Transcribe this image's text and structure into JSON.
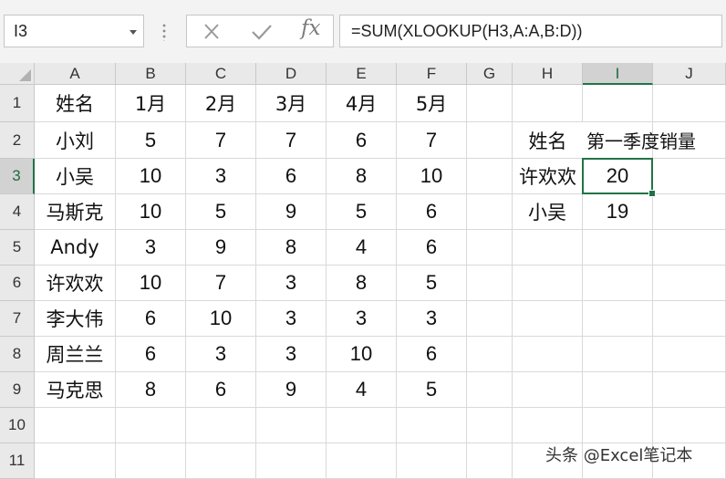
{
  "formula_bar": {
    "name_box": "I3",
    "cancel_icon": "close-icon",
    "enter_icon": "check-icon",
    "function_label": "fx",
    "formula": "=SUM(XLOOKUP(H3,A:A,B:D))"
  },
  "sheet": {
    "columns": [
      "A",
      "B",
      "C",
      "D",
      "E",
      "F",
      "G",
      "H",
      "I",
      "J"
    ],
    "rows": [
      "1",
      "2",
      "3",
      "4",
      "5",
      "6",
      "7",
      "8",
      "9",
      "10",
      "11"
    ],
    "selected_cell": "I3",
    "accent_color": "#217346",
    "cells": {
      "A1": "姓名",
      "B1": "1月",
      "C1": "2月",
      "D1": "3月",
      "E1": "4月",
      "F1": "5月",
      "A2": "小刘",
      "B2": "5",
      "C2": "7",
      "D2": "7",
      "E2": "6",
      "F2": "7",
      "A3": "小吴",
      "B3": "10",
      "C3": "3",
      "D3": "6",
      "E3": "8",
      "F3": "10",
      "A4": "马斯克",
      "B4": "10",
      "C4": "5",
      "D4": "9",
      "E4": "5",
      "F4": "6",
      "A5": "Andy",
      "B5": "3",
      "C5": "9",
      "D5": "8",
      "E5": "4",
      "F5": "6",
      "A6": "许欢欢",
      "B6": "10",
      "C6": "7",
      "D6": "3",
      "E6": "8",
      "F6": "5",
      "A7": "李大伟",
      "B7": "6",
      "C7": "10",
      "D7": "3",
      "E7": "3",
      "F7": "3",
      "A8": "周兰兰",
      "B8": "6",
      "C8": "3",
      "D8": "3",
      "E8": "10",
      "F8": "6",
      "A9": "马克思",
      "B9": "8",
      "C9": "6",
      "D9": "9",
      "E9": "4",
      "F9": "5",
      "H2": "姓名",
      "I2": "第一季度销量",
      "H3": "许欢欢",
      "I3": "20",
      "H4": "小吴",
      "I4": "19"
    }
  },
  "watermark": "头条 @Excel笔记本"
}
